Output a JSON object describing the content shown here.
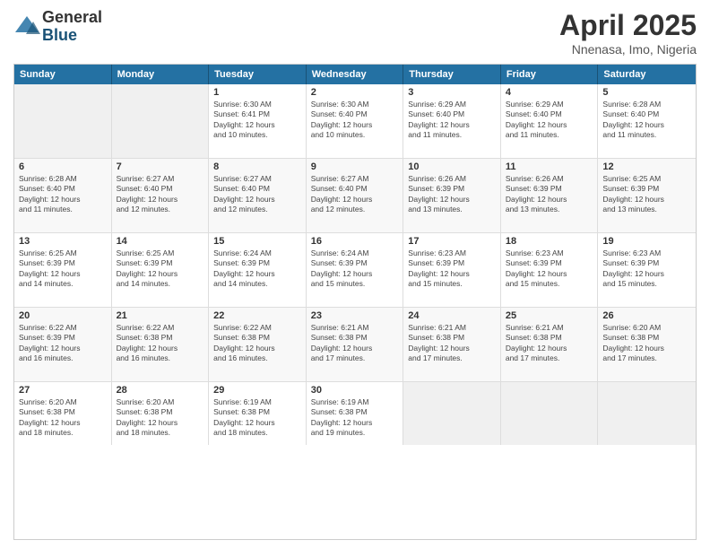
{
  "logo": {
    "general": "General",
    "blue": "Blue"
  },
  "title": "April 2025",
  "subtitle": "Nnenasa, Imo, Nigeria",
  "header_days": [
    "Sunday",
    "Monday",
    "Tuesday",
    "Wednesday",
    "Thursday",
    "Friday",
    "Saturday"
  ],
  "weeks": [
    [
      {
        "day": "",
        "info": ""
      },
      {
        "day": "",
        "info": ""
      },
      {
        "day": "1",
        "info": "Sunrise: 6:30 AM\nSunset: 6:41 PM\nDaylight: 12 hours\nand 10 minutes."
      },
      {
        "day": "2",
        "info": "Sunrise: 6:30 AM\nSunset: 6:40 PM\nDaylight: 12 hours\nand 10 minutes."
      },
      {
        "day": "3",
        "info": "Sunrise: 6:29 AM\nSunset: 6:40 PM\nDaylight: 12 hours\nand 11 minutes."
      },
      {
        "day": "4",
        "info": "Sunrise: 6:29 AM\nSunset: 6:40 PM\nDaylight: 12 hours\nand 11 minutes."
      },
      {
        "day": "5",
        "info": "Sunrise: 6:28 AM\nSunset: 6:40 PM\nDaylight: 12 hours\nand 11 minutes."
      }
    ],
    [
      {
        "day": "6",
        "info": "Sunrise: 6:28 AM\nSunset: 6:40 PM\nDaylight: 12 hours\nand 11 minutes."
      },
      {
        "day": "7",
        "info": "Sunrise: 6:27 AM\nSunset: 6:40 PM\nDaylight: 12 hours\nand 12 minutes."
      },
      {
        "day": "8",
        "info": "Sunrise: 6:27 AM\nSunset: 6:40 PM\nDaylight: 12 hours\nand 12 minutes."
      },
      {
        "day": "9",
        "info": "Sunrise: 6:27 AM\nSunset: 6:40 PM\nDaylight: 12 hours\nand 12 minutes."
      },
      {
        "day": "10",
        "info": "Sunrise: 6:26 AM\nSunset: 6:39 PM\nDaylight: 12 hours\nand 13 minutes."
      },
      {
        "day": "11",
        "info": "Sunrise: 6:26 AM\nSunset: 6:39 PM\nDaylight: 12 hours\nand 13 minutes."
      },
      {
        "day": "12",
        "info": "Sunrise: 6:25 AM\nSunset: 6:39 PM\nDaylight: 12 hours\nand 13 minutes."
      }
    ],
    [
      {
        "day": "13",
        "info": "Sunrise: 6:25 AM\nSunset: 6:39 PM\nDaylight: 12 hours\nand 14 minutes."
      },
      {
        "day": "14",
        "info": "Sunrise: 6:25 AM\nSunset: 6:39 PM\nDaylight: 12 hours\nand 14 minutes."
      },
      {
        "day": "15",
        "info": "Sunrise: 6:24 AM\nSunset: 6:39 PM\nDaylight: 12 hours\nand 14 minutes."
      },
      {
        "day": "16",
        "info": "Sunrise: 6:24 AM\nSunset: 6:39 PM\nDaylight: 12 hours\nand 15 minutes."
      },
      {
        "day": "17",
        "info": "Sunrise: 6:23 AM\nSunset: 6:39 PM\nDaylight: 12 hours\nand 15 minutes."
      },
      {
        "day": "18",
        "info": "Sunrise: 6:23 AM\nSunset: 6:39 PM\nDaylight: 12 hours\nand 15 minutes."
      },
      {
        "day": "19",
        "info": "Sunrise: 6:23 AM\nSunset: 6:39 PM\nDaylight: 12 hours\nand 15 minutes."
      }
    ],
    [
      {
        "day": "20",
        "info": "Sunrise: 6:22 AM\nSunset: 6:39 PM\nDaylight: 12 hours\nand 16 minutes."
      },
      {
        "day": "21",
        "info": "Sunrise: 6:22 AM\nSunset: 6:38 PM\nDaylight: 12 hours\nand 16 minutes."
      },
      {
        "day": "22",
        "info": "Sunrise: 6:22 AM\nSunset: 6:38 PM\nDaylight: 12 hours\nand 16 minutes."
      },
      {
        "day": "23",
        "info": "Sunrise: 6:21 AM\nSunset: 6:38 PM\nDaylight: 12 hours\nand 17 minutes."
      },
      {
        "day": "24",
        "info": "Sunrise: 6:21 AM\nSunset: 6:38 PM\nDaylight: 12 hours\nand 17 minutes."
      },
      {
        "day": "25",
        "info": "Sunrise: 6:21 AM\nSunset: 6:38 PM\nDaylight: 12 hours\nand 17 minutes."
      },
      {
        "day": "26",
        "info": "Sunrise: 6:20 AM\nSunset: 6:38 PM\nDaylight: 12 hours\nand 17 minutes."
      }
    ],
    [
      {
        "day": "27",
        "info": "Sunrise: 6:20 AM\nSunset: 6:38 PM\nDaylight: 12 hours\nand 18 minutes."
      },
      {
        "day": "28",
        "info": "Sunrise: 6:20 AM\nSunset: 6:38 PM\nDaylight: 12 hours\nand 18 minutes."
      },
      {
        "day": "29",
        "info": "Sunrise: 6:19 AM\nSunset: 6:38 PM\nDaylight: 12 hours\nand 18 minutes."
      },
      {
        "day": "30",
        "info": "Sunrise: 6:19 AM\nSunset: 6:38 PM\nDaylight: 12 hours\nand 19 minutes."
      },
      {
        "day": "",
        "info": ""
      },
      {
        "day": "",
        "info": ""
      },
      {
        "day": "",
        "info": ""
      }
    ]
  ]
}
